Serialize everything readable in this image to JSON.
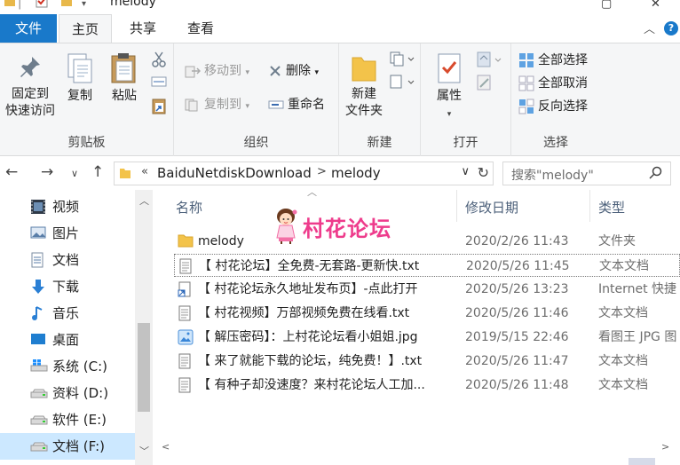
{
  "window": {
    "title": "melody"
  },
  "tabs": {
    "file": "文件",
    "home": "主页",
    "share": "共享",
    "view": "查看"
  },
  "ribbon": {
    "clipboard": {
      "pin_line1": "固定到",
      "pin_line2": "快速访问",
      "copy": "复制",
      "paste": "粘贴",
      "label": "剪贴板"
    },
    "organize": {
      "move_to": "移动到",
      "copy_to": "复制到",
      "delete": "删除",
      "rename": "重命名",
      "label": "组织"
    },
    "new": {
      "new_folder_line1": "新建",
      "new_folder_line2": "文件夹",
      "label": "新建"
    },
    "open": {
      "properties": "属性",
      "label": "打开"
    },
    "select": {
      "select_all": "全部选择",
      "select_none": "全部取消",
      "invert": "反向选择",
      "label": "选择"
    }
  },
  "address": {
    "more": "«",
    "crumbs": [
      "BaiduNetdiskDownload",
      "melody"
    ],
    "separator": ">",
    "search_placeholder": "搜索\"melody\""
  },
  "nav": {
    "items": [
      {
        "label": "视频",
        "icon": "video-folder-icon"
      },
      {
        "label": "图片",
        "icon": "pictures-folder-icon"
      },
      {
        "label": "文档",
        "icon": "documents-folder-icon"
      },
      {
        "label": "下载",
        "icon": "downloads-folder-icon"
      },
      {
        "label": "音乐",
        "icon": "music-folder-icon"
      },
      {
        "label": "桌面",
        "icon": "desktop-folder-icon"
      },
      {
        "label": "系统 (C:)",
        "icon": "windows-drive-icon"
      },
      {
        "label": "资料 (D:)",
        "icon": "drive-icon"
      },
      {
        "label": "软件 (E:)",
        "icon": "drive-icon"
      },
      {
        "label": "文档 (F:)",
        "icon": "drive-icon"
      }
    ]
  },
  "list": {
    "columns": {
      "name": "名称",
      "date": "修改日期",
      "type": "类型"
    },
    "rows": [
      {
        "name": "melody",
        "date": "2020/2/26 11:43",
        "type": "文件夹",
        "icon": "folder-icon"
      },
      {
        "name": "【 村花论坛】全免费-无套路-更新快.txt",
        "date": "2020/5/26 11:45",
        "type": "文本文档",
        "icon": "text-file-icon"
      },
      {
        "name": "【 村花论坛永久地址发布页】-点此打开",
        "date": "2020/5/26 13:23",
        "type": "Internet 快捷",
        "icon": "internet-shortcut-icon"
      },
      {
        "name": "【 村花视频】万部视频免费在线看.txt",
        "date": "2020/5/26 11:46",
        "type": "文本文档",
        "icon": "text-file-icon"
      },
      {
        "name": "【 解压密码】：上村花论坛看小姐姐.jpg",
        "date": "2019/5/15 22:46",
        "type": "看图王 JPG 图",
        "icon": "image-file-icon"
      },
      {
        "name": "【 来了就能下载的论坛，纯免费！】.txt",
        "date": "2020/5/26 11:47",
        "type": "文本文档",
        "icon": "text-file-icon"
      },
      {
        "name": "【 有种子却没速度？来村花论坛人工加...",
        "date": "2020/5/26 11:48",
        "type": "文本文档",
        "icon": "text-file-icon"
      }
    ]
  },
  "watermark": {
    "text": "村花论坛"
  },
  "colors": {
    "accent": "#1979ca",
    "selection": "#cce8ff",
    "watermark": "#ee3c8c"
  }
}
